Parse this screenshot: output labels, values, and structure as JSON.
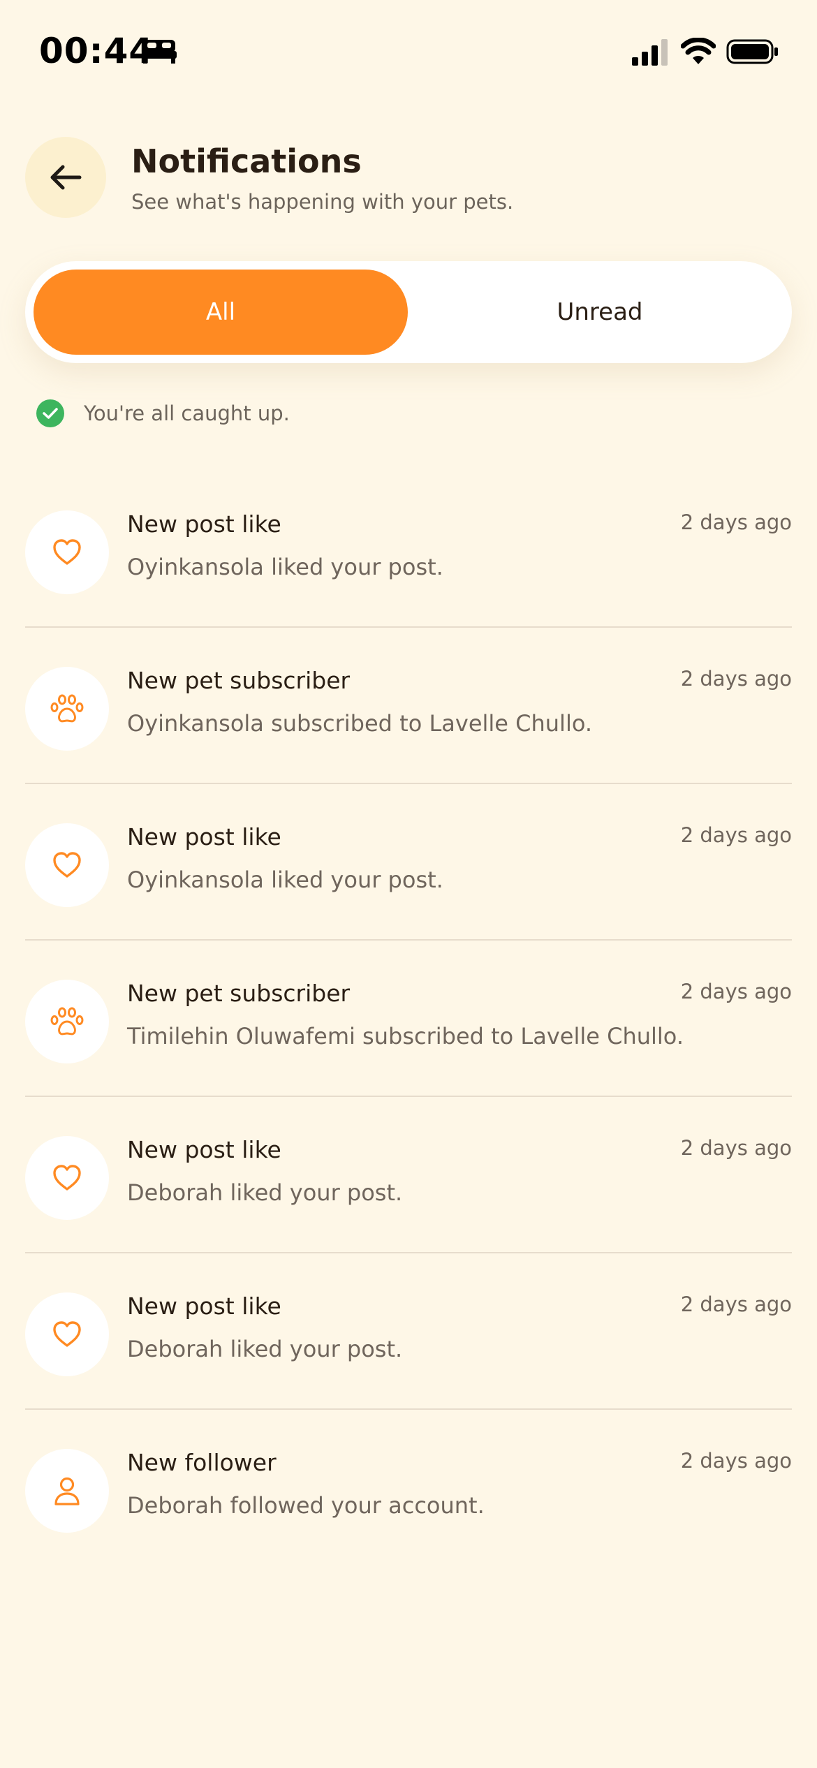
{
  "status_bar": {
    "time": "00:44"
  },
  "header": {
    "title": "Notifications",
    "subtitle": "See what's happening with your pets."
  },
  "tabs": {
    "all_label": "All",
    "unread_label": "Unread",
    "selected": "All"
  },
  "status_message": "You're all caught up.",
  "colors": {
    "accent": "#FF8A22",
    "background": "#FEF7E7",
    "success": "#3DB55E"
  },
  "notifications": [
    {
      "icon": "heart-icon",
      "title": "New post like",
      "body": "Oyinkansola liked your post.",
      "time": "2 days ago"
    },
    {
      "icon": "paw-icon",
      "title": "New pet subscriber",
      "body": "Oyinkansola subscribed to Lavelle Chullo.",
      "time": "2 days ago"
    },
    {
      "icon": "heart-icon",
      "title": "New post like",
      "body": "Oyinkansola liked your post.",
      "time": "2 days ago"
    },
    {
      "icon": "paw-icon",
      "title": "New pet subscriber",
      "body": "Timilehin Oluwafemi subscribed to Lavelle Chullo.",
      "time": "2 days ago"
    },
    {
      "icon": "heart-icon",
      "title": "New post like",
      "body": "Deborah liked your post.",
      "time": "2 days ago"
    },
    {
      "icon": "heart-icon",
      "title": "New post like",
      "body": "Deborah liked your post.",
      "time": "2 days ago"
    },
    {
      "icon": "user-icon",
      "title": "New follower",
      "body": "Deborah followed your account.",
      "time": "2 days ago"
    }
  ]
}
